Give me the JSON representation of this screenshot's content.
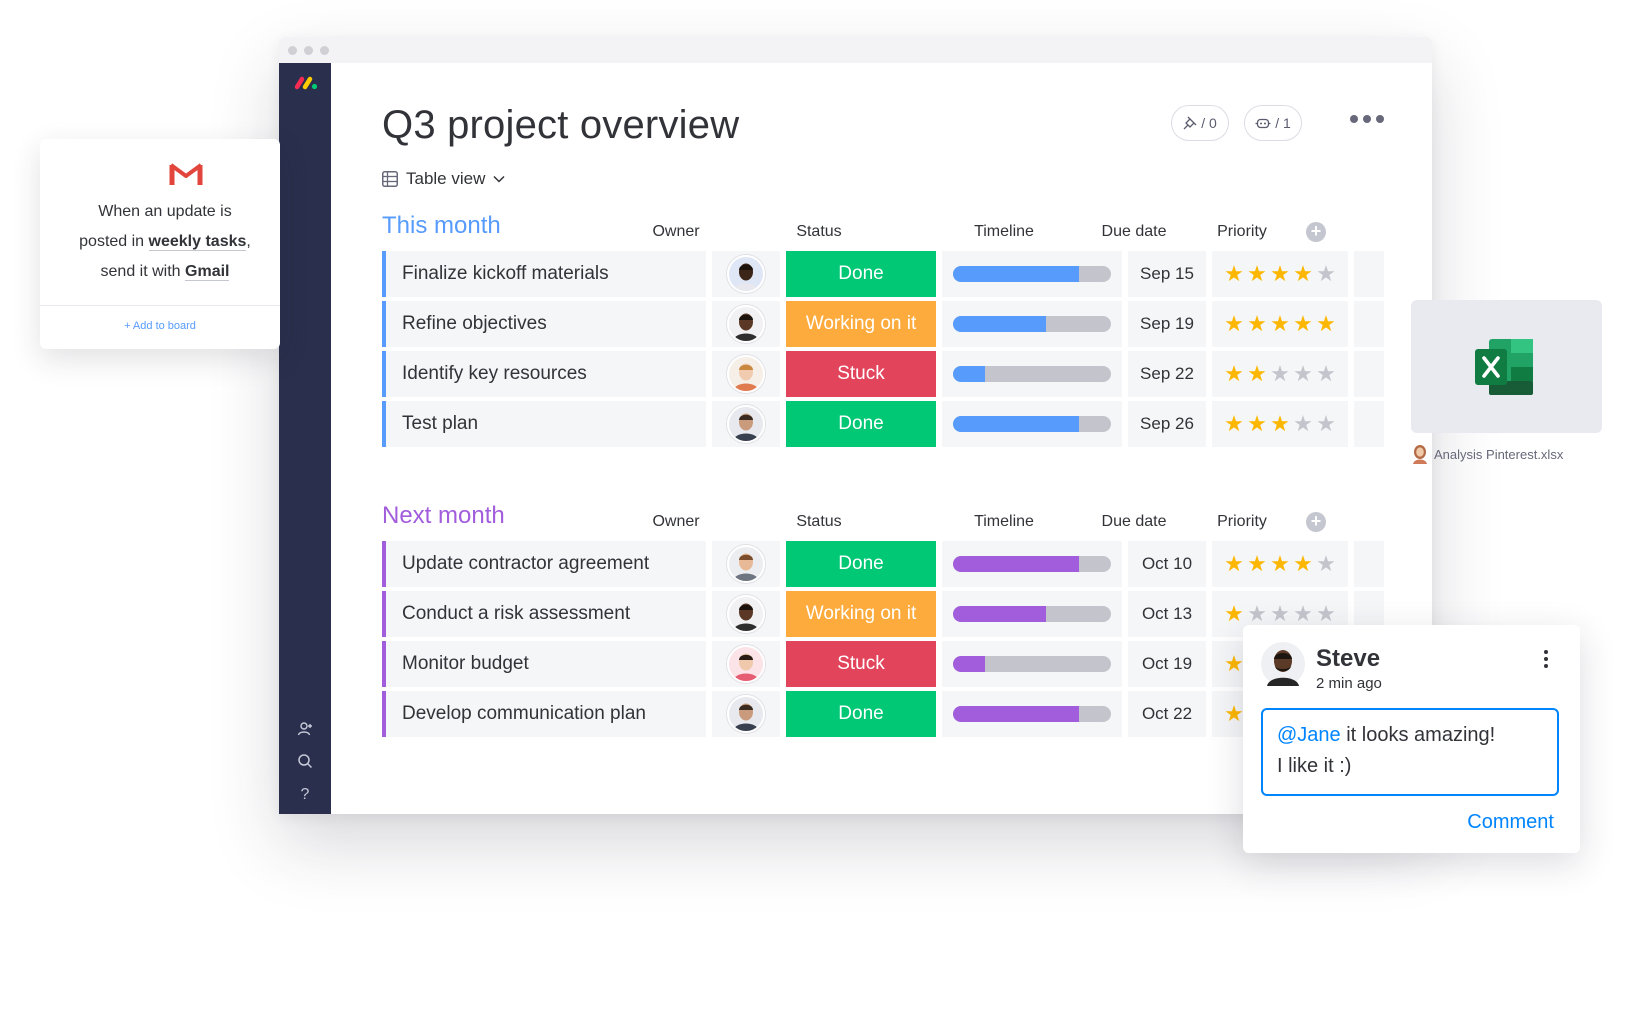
{
  "board": {
    "title": "Q3 project overview",
    "view_label": "Table view",
    "header_pills": [
      {
        "icon": "pin-icon",
        "label": "/ 0"
      },
      {
        "icon": "robot-icon",
        "label": "/ 1"
      }
    ]
  },
  "columns": {
    "owner": "Owner",
    "status": "Status",
    "timeline": "Timeline",
    "due_date": "Due date",
    "priority": "Priority"
  },
  "groups": [
    {
      "title": "This month",
      "color": "#579bfc",
      "rows": [
        {
          "item": "Finalize kickoff materials",
          "status": "Done",
          "status_color": "#00c875",
          "timeline": 0.8,
          "due": "Sep 15",
          "priority": 4
        },
        {
          "item": "Refine objectives",
          "status": "Working on it",
          "status_color": "#fdab3d",
          "timeline": 0.59,
          "due": "Sep 19",
          "priority": 5
        },
        {
          "item": "Identify key resources",
          "status": "Stuck",
          "status_color": "#e2445c",
          "timeline": 0.2,
          "due": "Sep 22",
          "priority": 2
        },
        {
          "item": "Test plan",
          "status": "Done",
          "status_color": "#00c875",
          "timeline": 0.8,
          "due": "Sep 26",
          "priority": 3
        }
      ]
    },
    {
      "title": "Next month",
      "color": "#a25ddc",
      "rows": [
        {
          "item": "Update contractor agreement",
          "status": "Done",
          "status_color": "#00c875",
          "timeline": 0.8,
          "due": "Oct 10",
          "priority": 4
        },
        {
          "item": "Conduct a risk assessment",
          "status": "Working on it",
          "status_color": "#fdab3d",
          "timeline": 0.59,
          "due": "Oct 13",
          "priority": 1
        },
        {
          "item": "Monitor budget",
          "status": "Stuck",
          "status_color": "#e2445c",
          "timeline": 0.2,
          "due": "Oct 19",
          "priority": 1
        },
        {
          "item": "Develop communication plan",
          "status": "Done",
          "status_color": "#00c875",
          "timeline": 0.8,
          "due": "Oct 22",
          "priority": 1
        }
      ]
    }
  ],
  "gmail_card": {
    "line1": "When an update is",
    "line2_prefix": "posted in",
    "line2_bold": "weekly tasks",
    "line2_suffix": ",",
    "line3_prefix": "send it with",
    "line3_bold": "Gmail",
    "add_link": "+ Add to board"
  },
  "file_card": {
    "file_name": "Analysis Pinterest.xlsx"
  },
  "comment_card": {
    "author": "Steve",
    "time": "2 min ago",
    "mention": "@Jane",
    "text_rest": " it looks amazing!",
    "text_line2": "I like it :)",
    "submit_label": "Comment"
  }
}
